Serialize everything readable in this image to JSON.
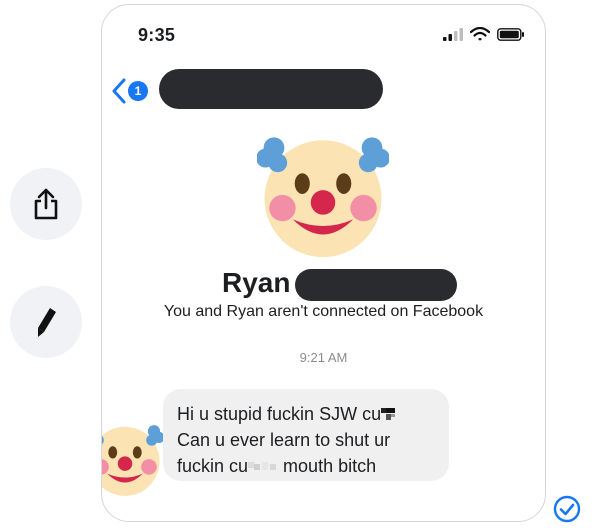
{
  "status": {
    "time": "9:35"
  },
  "nav": {
    "back_badge": "1"
  },
  "profile": {
    "name": "Ryan",
    "connection_text": "You and Ryan aren't connected on Facebook"
  },
  "chat": {
    "timestamp": "9:21 AM",
    "message": {
      "line1": "Hi u stupid fuckin SJW cu",
      "line2": "Can u ever learn to shut ur",
      "line3a": "fuckin cu",
      "line3b": " mouth bitch"
    }
  },
  "icons": {
    "share": "share-icon",
    "edit": "pencil-icon",
    "back": "chevron-left-icon",
    "sent": "check-circle-icon",
    "avatar": "clown-face-emoji"
  },
  "colors": {
    "accent": "#1877f2",
    "bubble": "#f0f0f0",
    "redaction": "#2a2b2e"
  }
}
